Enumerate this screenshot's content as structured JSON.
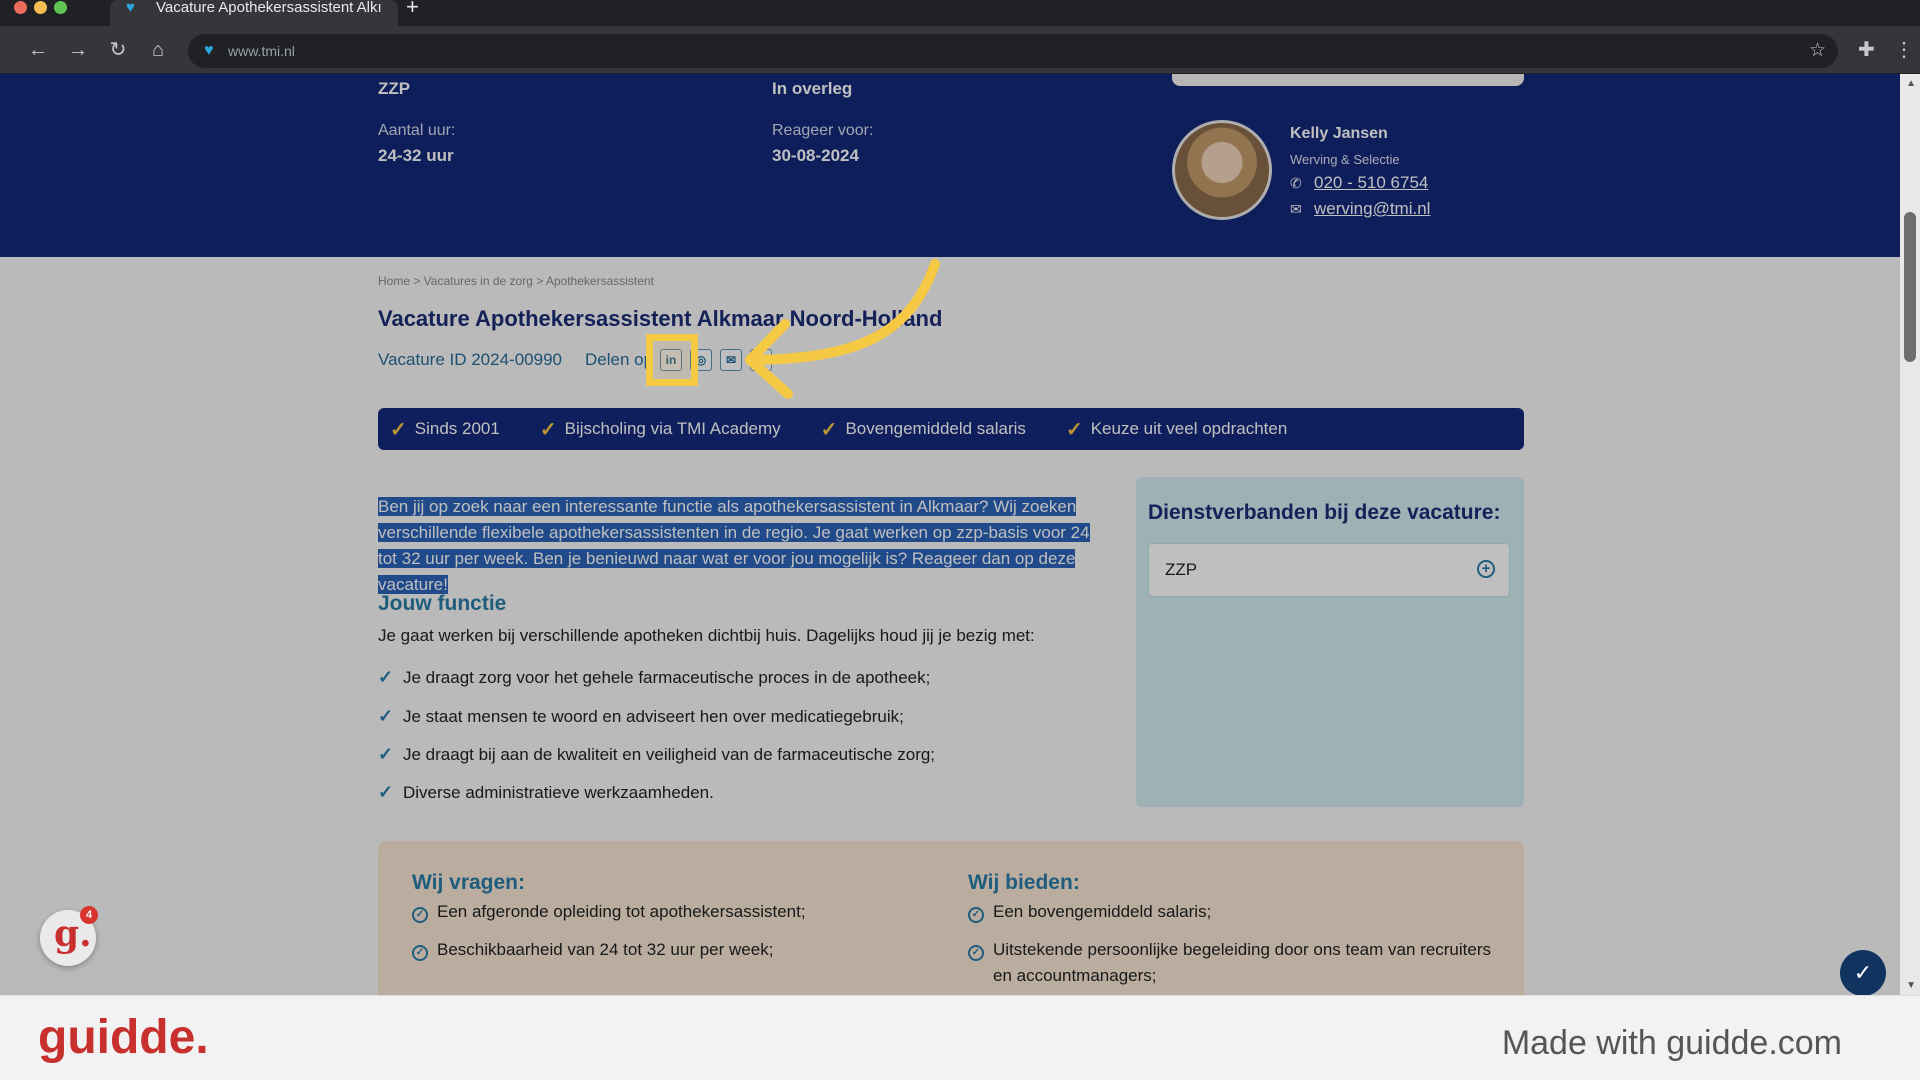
{
  "browser": {
    "tab_title": "Vacature Apothekersassistent Alkı",
    "new_tab": "+",
    "url": "www.tmi.nl",
    "traffic_colors": [
      "#ed6a5e",
      "#f5bf4f",
      "#61c554"
    ]
  },
  "hero": {
    "type_value": "ZZP",
    "salary_value": "In overleg",
    "hours_label": "Aantal uur:",
    "hours_value": "24-32 uur",
    "respond_label": "Reageer voor:",
    "respond_value": "30-08-2024",
    "contact": {
      "name": "Kelly Jansen",
      "role": "Werving & Selectie",
      "phone": "020 - 510 6754",
      "email": "werving@tmi.nl"
    }
  },
  "breadcrumb": "Home > Vacatures in de zorg > Apothekersassistent",
  "job": {
    "title": "Vacature Apothekersassistent Alkmaar Noord-Holland",
    "id": "Vacature ID 2024-00990",
    "share_label": "Delen op",
    "share_icons": [
      "in",
      "◎",
      "✉",
      ""
    ]
  },
  "usps": [
    "Sinds 2001",
    "Bijscholing via TMI Academy",
    "Bovengemiddeld salaris",
    "Keuze uit veel opdrachten"
  ],
  "intro": "Ben jij op zoek naar een interessante functie als apothekersassistent in Alkmaar? Wij zoeken verschillende flexibele apothekersassistenten in de regio. Je gaat werken op zzp-basis voor 24 tot 32 uur per week. Ben je benieuwd naar wat er voor jou mogelijk is? Reageer dan op deze vacature!",
  "function": {
    "heading": "Jouw functie",
    "intro": "Je gaat werken bij verschillende apotheken dichtbij huis. Dagelijks houd jij je bezig met:",
    "items": [
      "Je draagt zorg voor het gehele farmaceutische proces in de apotheek;",
      "Je staat mensen te woord en adviseert hen over medicatiegebruik;",
      "Je draagt bij aan de kwaliteit en veiligheid van de farmaceutische zorg;",
      "Diverse administratieve werkzaamheden."
    ]
  },
  "sidebar": {
    "title": "Dienstverbanden bij deze vacature:",
    "item": "ZZP"
  },
  "requirements": {
    "ask_heading": "Wij vragen:",
    "ask_items": [
      "Een afgeronde opleiding tot apothekersassistent;",
      "Beschikbaarheid van 24 tot 32 uur per week;"
    ],
    "offer_heading": "Wij bieden:",
    "offer_items": [
      "Een bovengemiddeld salaris;",
      "Uitstekende persoonlijke begeleiding door ons team van recruiters en accountmanagers;"
    ]
  },
  "guidde": {
    "badge_letter": "g.",
    "badge_count": "4",
    "footer_logo": "guidde.",
    "footer_made": "Made with guidde.com"
  }
}
